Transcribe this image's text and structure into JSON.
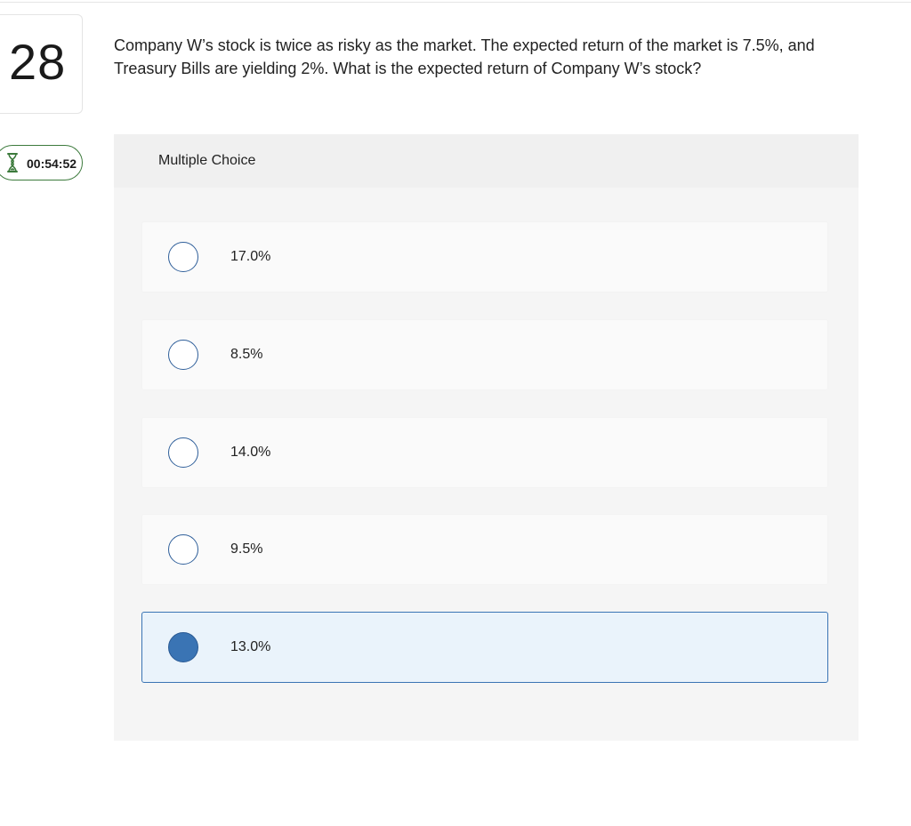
{
  "question": {
    "number": "28",
    "text": "Company W’s stock is twice as risky as the market. The expected return of the market is 7.5%, and Treasury Bills are yielding 2%.  What is the expected return of Company W’s stock?"
  },
  "timer": {
    "icon": "hourglass-icon",
    "value": "00:54:52",
    "accent": "#3c7a3c"
  },
  "choices": {
    "title": "Multiple Choice",
    "options": [
      {
        "label": "17.0%",
        "selected": false
      },
      {
        "label": "8.5%",
        "selected": false
      },
      {
        "label": "14.0%",
        "selected": false
      },
      {
        "label": "9.5%",
        "selected": false
      },
      {
        "label": "13.0%",
        "selected": true
      }
    ],
    "selected_color": "#3a74b4"
  }
}
